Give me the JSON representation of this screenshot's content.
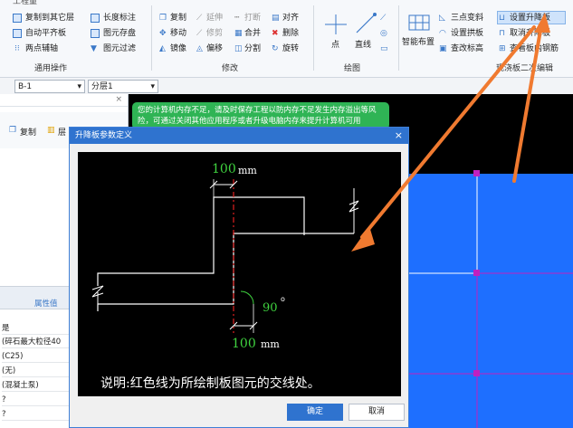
{
  "ribbon": {
    "top_partial": "工程量",
    "cmd_copy_to_floor": "复制到其它层",
    "cmd_auto_flat": "自动平齐板",
    "cmd_two_point_axis": "两点辅轴",
    "group_common": "通用操作",
    "cmd_length_mark": "长度标注",
    "cmd_element_store": "图元存盘",
    "cmd_element_filter": "图元过滤",
    "cmd_copy": "复制",
    "cmd_extend": "延伸",
    "cmd_break": "打断",
    "cmd_align": "对齐",
    "cmd_move": "移动",
    "cmd_trim": "修剪",
    "cmd_merge": "合并",
    "cmd_delete": "删除",
    "cmd_mirror": "镜像",
    "cmd_offset": "偏移",
    "cmd_split": "分割",
    "cmd_rotate": "旋转",
    "group_modify": "修改",
    "cmd_point": "点",
    "cmd_line": "直线",
    "group_draw": "绘图",
    "cmd_smart_layout": "智能布置",
    "cmd_three_point_slope": "三点变斜",
    "cmd_set_slab_slope": "设置拱板",
    "cmd_view_rebar": "查改标高",
    "cmd_set_drop": "设置升降板",
    "cmd_cancel_drop": "取消升降板",
    "cmd_view_slab_rebar": "查看板内钢筋",
    "group_secondary": "现浇板二次编辑"
  },
  "toolbar": {
    "floor_select": "B-1",
    "layer_select": "分层1"
  },
  "left_panel": {
    "btn_copy": "复制",
    "btn_layer_partial": "层",
    "prop_header": "属性值",
    "props": [
      "是",
      "(碎石最大粒径40",
      "(C25)",
      "(无)",
      "(混凝土泵)",
      "?",
      "?"
    ]
  },
  "warning": {
    "text": "您的计算机内存不足，请及时保存工程以防内存不足发生内存溢出等风险，可通过关闭其他应用程序或者升级电脑内存来提升计算机可用"
  },
  "dialog": {
    "title": "升降板参数定义",
    "dim_top": "100",
    "dim_unit": "mm",
    "dim_bottom": "100",
    "angle": "90",
    "note": "说明:红色线为所绘制板图元的交线处。",
    "ok": "确定",
    "cancel": "取消"
  },
  "colors": {
    "accent": "#2f73cf",
    "canvas_bg": "#000000",
    "slab_blue": "#1e6fff",
    "arrow_orange": "#f07a30",
    "dim_green": "#3fd23f",
    "red_line": "#e02020",
    "warn_green": "#2fb455",
    "magenta_mark": "#c020c0"
  }
}
